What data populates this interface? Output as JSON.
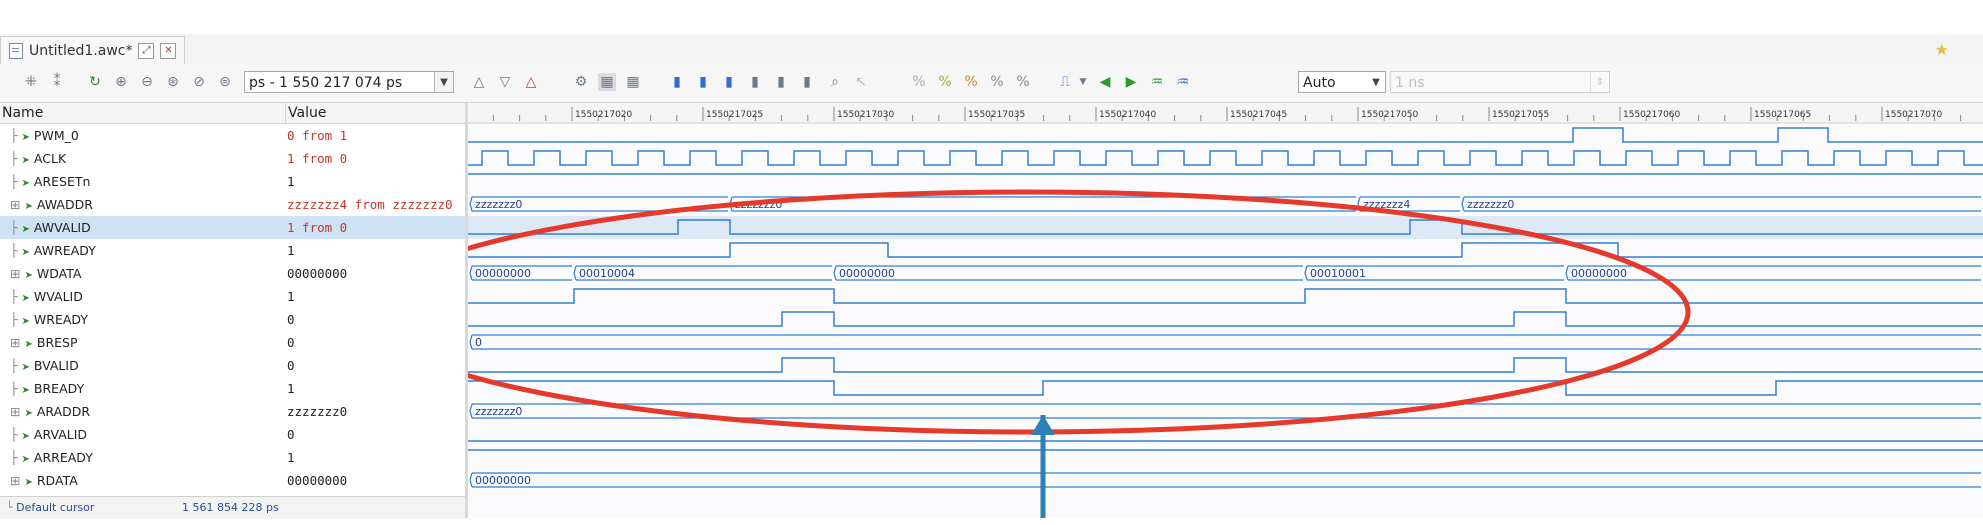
{
  "tab": {
    "title": "Untitled1.awc*",
    "float_btn": "⤢",
    "close_btn": "✕"
  },
  "toolbar": {
    "time_combo": "ps - 1 550 217 074 ps",
    "zoom_mode": "Auto",
    "step_input_placeholder": "1 ns"
  },
  "columns": {
    "name": "Name",
    "value": "Value"
  },
  "signals": [
    {
      "name": "PWM_0",
      "value": "0 from 1",
      "expandable": false,
      "value_color": "red"
    },
    {
      "name": "ACLK",
      "value": "1 from 0",
      "expandable": false,
      "value_color": "red"
    },
    {
      "name": "ARESETn",
      "value": "1",
      "expandable": false,
      "value_color": "dark"
    },
    {
      "name": "AWADDR",
      "value": "zzzzzzz4 from zzzzzzz0",
      "expandable": true,
      "value_color": "red"
    },
    {
      "name": "AWVALID",
      "value": "1 from 0",
      "expandable": false,
      "value_color": "red",
      "selected": true
    },
    {
      "name": "AWREADY",
      "value": "1",
      "expandable": false,
      "value_color": "dark"
    },
    {
      "name": "WDATA",
      "value": "00000000",
      "expandable": true,
      "value_color": "dark"
    },
    {
      "name": "WVALID",
      "value": "1",
      "expandable": false,
      "value_color": "dark"
    },
    {
      "name": "WREADY",
      "value": "0",
      "expandable": false,
      "value_color": "dark"
    },
    {
      "name": "BRESP",
      "value": "0",
      "expandable": true,
      "value_color": "dark"
    },
    {
      "name": "BVALID",
      "value": "0",
      "expandable": false,
      "value_color": "dark"
    },
    {
      "name": "BREADY",
      "value": "1",
      "expandable": false,
      "value_color": "dark"
    },
    {
      "name": "ARADDR",
      "value": "zzzzzzz0",
      "expandable": true,
      "value_color": "dark"
    },
    {
      "name": "ARVALID",
      "value": "0",
      "expandable": false,
      "value_color": "dark"
    },
    {
      "name": "ARREADY",
      "value": "1",
      "expandable": false,
      "value_color": "dark"
    },
    {
      "name": "RDATA",
      "value": "00000000",
      "expandable": true,
      "value_color": "dark"
    }
  ],
  "cursor": {
    "label": "Default cursor",
    "time": "1 561 854 228 ps"
  },
  "timeline": {
    "labels": [
      "1550217020",
      "1550217025",
      "1550217030",
      "1550217035",
      "1550217040",
      "1550217045",
      "1550217050",
      "1550217055",
      "1550217060",
      "1550217065",
      "1550217070"
    ]
  },
  "bus_labels": {
    "awaddr": [
      "zzzzzzz0",
      "zzzzzzz0",
      "zzzzzzz4",
      "zzzzzzz0"
    ],
    "wdata": [
      "00000000",
      "00010004",
      "00000000",
      "00010001",
      "00000000"
    ],
    "bresp": [
      "0"
    ],
    "araddr": [
      "zzzzzzz0"
    ],
    "rdata": [
      "00000000"
    ]
  },
  "colors": {
    "wave": "#2f7fd6",
    "annotation_ellipse": "#e5392b",
    "annotation_arrow": "#2e7fb3",
    "selected_row": "#cfe2f5"
  }
}
